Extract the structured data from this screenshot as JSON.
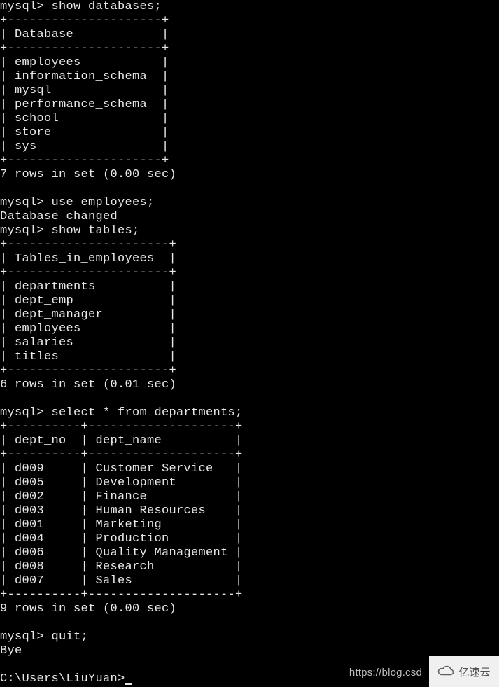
{
  "session": {
    "prompt": "mysql>",
    "cmd_show_databases": "show databases;",
    "databases_header": "Database",
    "databases": [
      "employees",
      "information_schema",
      "mysql",
      "performance_schema",
      "school",
      "store",
      "sys"
    ],
    "databases_count_line": "7 rows in set (0.00 sec)",
    "cmd_use": "use employees;",
    "use_response": "Database changed",
    "cmd_show_tables": "show tables;",
    "tables_header": "Tables_in_employees",
    "tables": [
      "departments",
      "dept_emp",
      "dept_manager",
      "employees",
      "salaries",
      "titles"
    ],
    "tables_count_line": "6 rows in set (0.01 sec)",
    "cmd_select": "select * from departments;",
    "dept_columns": [
      "dept_no",
      "dept_name"
    ],
    "departments": [
      {
        "no": "d009",
        "name": "Customer Service"
      },
      {
        "no": "d005",
        "name": "Development"
      },
      {
        "no": "d002",
        "name": "Finance"
      },
      {
        "no": "d003",
        "name": "Human Resources"
      },
      {
        "no": "d001",
        "name": "Marketing"
      },
      {
        "no": "d004",
        "name": "Production"
      },
      {
        "no": "d006",
        "name": "Quality Management"
      },
      {
        "no": "d008",
        "name": "Research"
      },
      {
        "no": "d007",
        "name": "Sales"
      }
    ],
    "dept_count_line": "9 rows in set (0.00 sec)",
    "cmd_quit": "quit;",
    "quit_response": "Bye",
    "os_prompt": "C:\\Users\\LiuYuan>"
  },
  "watermark": {
    "url": "https://blog.csd",
    "brand": "亿速云"
  }
}
